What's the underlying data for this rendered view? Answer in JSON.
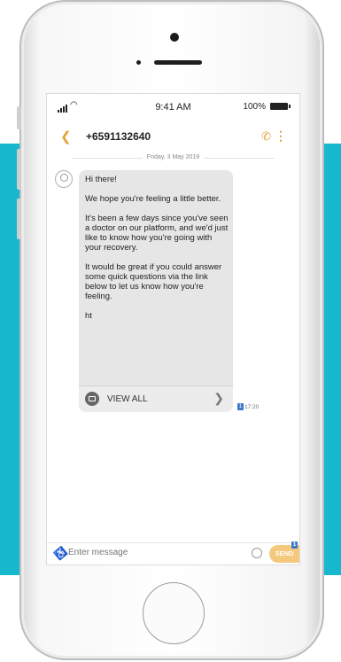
{
  "status_bar": {
    "time": "9:41 AM",
    "battery": "100%"
  },
  "header": {
    "phone_number": "+6591132640"
  },
  "date_separator": "Friday, 3 May 2019",
  "message": {
    "text": "Hi there!\n\nWe hope you're feeling a little better.\n\nIt's been a few days since you've seen a doctor on our platform, and we'd just like to know how you're going with your recovery.\n\nIt would be great if you could answer some quick questions via the link below to let us know how you're feeling.\n\nht",
    "view_all_label": "VIEW ALL",
    "sim_indicator": "1",
    "time": "17:20"
  },
  "compose": {
    "placeholder": "Enter message",
    "send_label": "SEND",
    "sim_indicator": "1"
  },
  "colors": {
    "accent": "#e3a23a",
    "background_band": "#17b7cd",
    "bubble": "#e6e6e6",
    "sim_badge": "#3d79c8"
  },
  "icons": [
    "signal-icon",
    "wifi-icon",
    "battery-icon",
    "back-icon",
    "phone-call-icon",
    "more-options-icon",
    "avatar-icon",
    "link-preview-icon",
    "chevron-right-icon",
    "attach-icon",
    "emoji-icon"
  ]
}
